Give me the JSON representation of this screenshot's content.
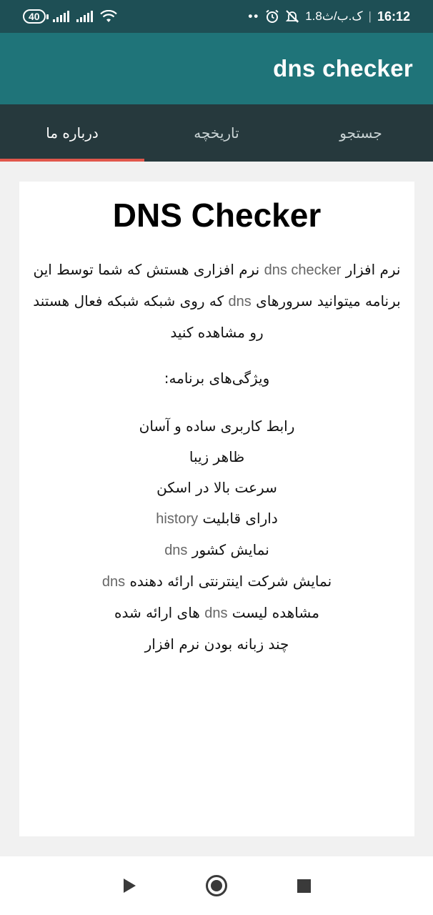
{
  "status_bar": {
    "battery": "40",
    "time": "16:12",
    "network_speed": "1.8ک.ب/ث",
    "dots": "••"
  },
  "app_bar": {
    "title": "dns checker"
  },
  "tabs": [
    {
      "label": "درباره ما",
      "active": true
    },
    {
      "label": "تاریخچه",
      "active": false
    },
    {
      "label": "جستجو",
      "active": false
    }
  ],
  "content": {
    "title": "DNS Checker",
    "intro": {
      "part1": "نرم افزار ",
      "app_name": "dns checker",
      "part2": " نرم افزاری هستش که شما توسط این برنامه میتوانید سرورهای ",
      "dns": "dns",
      "part3": " که روی شبکه شبکه فعال هستند رو مشاهده کنید"
    },
    "features_title": "ویژگی‌های برنامه:",
    "features": {
      "f1": "رابط کاربری ساده و آسان",
      "f2": "ظاهر زیبا",
      "f3": "سرعت بالا در اسکن",
      "f4_text": "دارای قابلیت ",
      "f4_latin": "history",
      "f5_text": "نمایش کشور ",
      "f5_latin": "dns",
      "f6_text": "نمایش شرکت اینترنتی ارائه دهنده ",
      "f6_latin": "dns",
      "f7_text1": "مشاهده لیست ",
      "f7_latin": "dns",
      "f7_text2": " های ارائه شده",
      "f8": "چند زبانه بودن نرم افزار"
    }
  },
  "colors": {
    "status_bar": "#1e4f55",
    "app_bar": "#1f7479",
    "tab_bar": "#26393d",
    "tab_indicator": "#e1574b"
  },
  "icons": {
    "back": "triangle-back-icon",
    "home": "circle-home-icon",
    "recents": "square-recents-icon"
  }
}
